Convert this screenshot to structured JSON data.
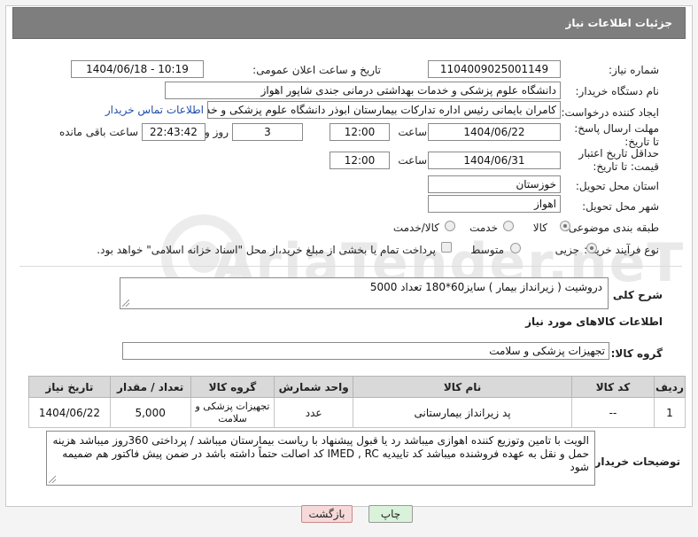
{
  "title": "جزئیات اطلاعات نیاز",
  "fields": {
    "need_number_label": "شماره نیاز:",
    "need_number": "1104009025001149",
    "announce_label": "تاریخ و ساعت اعلان عمومی:",
    "announce_value": "1404/06/18 - 10:19",
    "buyer_org_label": "نام دستگاه خریدار:",
    "buyer_org": "دانشگاه علوم پزشکی و خدمات بهداشتی درمانی جندی شاپور اهواز",
    "requester_label": "ایجاد کننده درخواست:",
    "requester": "کامران بایمانی رئیس اداره تدارکات بیمارستان ابوذر  دانشگاه علوم پزشکی و خدمات بهداشتی درمانی جندی شاپور اهواز",
    "contact_link": "اطلاعات تماس خریدار",
    "reply_deadline_label": "مهلت ارسال پاسخ: تا تاریخ:",
    "reply_date": "1404/06/22",
    "time_word": "ساعت",
    "reply_time": "12:00",
    "days_count": "3",
    "days_word": "روز و",
    "remaining_time": "22:43:42",
    "remaining_label": "ساعت باقی مانده",
    "price_validity_label": "حداقل تاریخ اعتبار قیمت: تا تاریخ:",
    "price_date": "1404/06/31",
    "price_time": "12:00",
    "province_label": "استان محل تحویل:",
    "province": "خوزستان",
    "city_label": "شهر محل تحویل:",
    "city": "اهواز",
    "category_label": "طبقه بندی موضوعی:",
    "category_options": [
      "کالا",
      "خدمت",
      "کالا/خدمت"
    ],
    "process_label": "نوع فرآیند خرید :",
    "process_options": [
      "جزیی",
      "متوسط"
    ],
    "payment_note": "پرداخت تمام یا بخشی از مبلغ خرید،از محل \"اسناد خزانه اسلامی\" خواهد بود."
  },
  "description": {
    "label": "شرح کلی نیاز:",
    "text": "دروشیت ( زیرانداز بیمار ) سایز60*180 تعداد 5000"
  },
  "goods_section": {
    "title": "اطلاعات کالاهای مورد نیاز",
    "group_label": "گروه کالا:",
    "group_value": "تجهیزات پزشکی و سلامت"
  },
  "table": {
    "headers": [
      "ردیف",
      "کد کالا",
      "نام کالا",
      "واحد شمارش",
      "گروه کالا",
      "تعداد / مقدار",
      "تاریخ نیاز"
    ],
    "rows": [
      [
        "1",
        "--",
        "پد زیرانداز بیمارستانی",
        "عدد",
        "تجهیزات پزشکی و سلامت",
        "5,000",
        "1404/06/22"
      ]
    ]
  },
  "buyer_notes": {
    "label": "توضیحات خریدار:",
    "text": "الویت با تامین وتوزیع کننده اهوازی میباشد رد یا قبول پیشنهاد با ریاست بیمارستان میباشد / پرداختی  360روز  میباشد  هزینه حمل و نقل به عهده فروشنده میباشد کد تاییدیه IMED , RC کد اصالت حتماً داشته باشد در ضمن پیش فاکتور هم ضمیمه شود"
  },
  "watermark": "AriaTender.neT",
  "buttons": {
    "print": "چاپ",
    "back": "بازگشت"
  },
  "colors": {
    "header_bg": "#7e7e7e",
    "link": "#1f4ea8",
    "back_button_bg": "#f7d9d9",
    "print_button_bg": "#d9f2d9"
  }
}
